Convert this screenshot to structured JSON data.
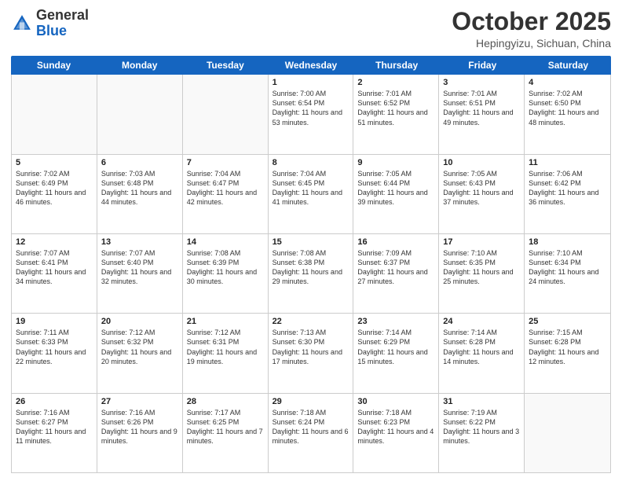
{
  "header": {
    "logo_general": "General",
    "logo_blue": "Blue",
    "month_title": "October 2025",
    "location": "Hepingyizu, Sichuan, China"
  },
  "days_of_week": [
    "Sunday",
    "Monday",
    "Tuesday",
    "Wednesday",
    "Thursday",
    "Friday",
    "Saturday"
  ],
  "weeks": [
    [
      {
        "day": "",
        "sunrise": "",
        "sunset": "",
        "daylight": ""
      },
      {
        "day": "",
        "sunrise": "",
        "sunset": "",
        "daylight": ""
      },
      {
        "day": "",
        "sunrise": "",
        "sunset": "",
        "daylight": ""
      },
      {
        "day": "1",
        "sunrise": "Sunrise: 7:00 AM",
        "sunset": "Sunset: 6:54 PM",
        "daylight": "Daylight: 11 hours and 53 minutes."
      },
      {
        "day": "2",
        "sunrise": "Sunrise: 7:01 AM",
        "sunset": "Sunset: 6:52 PM",
        "daylight": "Daylight: 11 hours and 51 minutes."
      },
      {
        "day": "3",
        "sunrise": "Sunrise: 7:01 AM",
        "sunset": "Sunset: 6:51 PM",
        "daylight": "Daylight: 11 hours and 49 minutes."
      },
      {
        "day": "4",
        "sunrise": "Sunrise: 7:02 AM",
        "sunset": "Sunset: 6:50 PM",
        "daylight": "Daylight: 11 hours and 48 minutes."
      }
    ],
    [
      {
        "day": "5",
        "sunrise": "Sunrise: 7:02 AM",
        "sunset": "Sunset: 6:49 PM",
        "daylight": "Daylight: 11 hours and 46 minutes."
      },
      {
        "day": "6",
        "sunrise": "Sunrise: 7:03 AM",
        "sunset": "Sunset: 6:48 PM",
        "daylight": "Daylight: 11 hours and 44 minutes."
      },
      {
        "day": "7",
        "sunrise": "Sunrise: 7:04 AM",
        "sunset": "Sunset: 6:47 PM",
        "daylight": "Daylight: 11 hours and 42 minutes."
      },
      {
        "day": "8",
        "sunrise": "Sunrise: 7:04 AM",
        "sunset": "Sunset: 6:45 PM",
        "daylight": "Daylight: 11 hours and 41 minutes."
      },
      {
        "day": "9",
        "sunrise": "Sunrise: 7:05 AM",
        "sunset": "Sunset: 6:44 PM",
        "daylight": "Daylight: 11 hours and 39 minutes."
      },
      {
        "day": "10",
        "sunrise": "Sunrise: 7:05 AM",
        "sunset": "Sunset: 6:43 PM",
        "daylight": "Daylight: 11 hours and 37 minutes."
      },
      {
        "day": "11",
        "sunrise": "Sunrise: 7:06 AM",
        "sunset": "Sunset: 6:42 PM",
        "daylight": "Daylight: 11 hours and 36 minutes."
      }
    ],
    [
      {
        "day": "12",
        "sunrise": "Sunrise: 7:07 AM",
        "sunset": "Sunset: 6:41 PM",
        "daylight": "Daylight: 11 hours and 34 minutes."
      },
      {
        "day": "13",
        "sunrise": "Sunrise: 7:07 AM",
        "sunset": "Sunset: 6:40 PM",
        "daylight": "Daylight: 11 hours and 32 minutes."
      },
      {
        "day": "14",
        "sunrise": "Sunrise: 7:08 AM",
        "sunset": "Sunset: 6:39 PM",
        "daylight": "Daylight: 11 hours and 30 minutes."
      },
      {
        "day": "15",
        "sunrise": "Sunrise: 7:08 AM",
        "sunset": "Sunset: 6:38 PM",
        "daylight": "Daylight: 11 hours and 29 minutes."
      },
      {
        "day": "16",
        "sunrise": "Sunrise: 7:09 AM",
        "sunset": "Sunset: 6:37 PM",
        "daylight": "Daylight: 11 hours and 27 minutes."
      },
      {
        "day": "17",
        "sunrise": "Sunrise: 7:10 AM",
        "sunset": "Sunset: 6:35 PM",
        "daylight": "Daylight: 11 hours and 25 minutes."
      },
      {
        "day": "18",
        "sunrise": "Sunrise: 7:10 AM",
        "sunset": "Sunset: 6:34 PM",
        "daylight": "Daylight: 11 hours and 24 minutes."
      }
    ],
    [
      {
        "day": "19",
        "sunrise": "Sunrise: 7:11 AM",
        "sunset": "Sunset: 6:33 PM",
        "daylight": "Daylight: 11 hours and 22 minutes."
      },
      {
        "day": "20",
        "sunrise": "Sunrise: 7:12 AM",
        "sunset": "Sunset: 6:32 PM",
        "daylight": "Daylight: 11 hours and 20 minutes."
      },
      {
        "day": "21",
        "sunrise": "Sunrise: 7:12 AM",
        "sunset": "Sunset: 6:31 PM",
        "daylight": "Daylight: 11 hours and 19 minutes."
      },
      {
        "day": "22",
        "sunrise": "Sunrise: 7:13 AM",
        "sunset": "Sunset: 6:30 PM",
        "daylight": "Daylight: 11 hours and 17 minutes."
      },
      {
        "day": "23",
        "sunrise": "Sunrise: 7:14 AM",
        "sunset": "Sunset: 6:29 PM",
        "daylight": "Daylight: 11 hours and 15 minutes."
      },
      {
        "day": "24",
        "sunrise": "Sunrise: 7:14 AM",
        "sunset": "Sunset: 6:28 PM",
        "daylight": "Daylight: 11 hours and 14 minutes."
      },
      {
        "day": "25",
        "sunrise": "Sunrise: 7:15 AM",
        "sunset": "Sunset: 6:28 PM",
        "daylight": "Daylight: 11 hours and 12 minutes."
      }
    ],
    [
      {
        "day": "26",
        "sunrise": "Sunrise: 7:16 AM",
        "sunset": "Sunset: 6:27 PM",
        "daylight": "Daylight: 11 hours and 11 minutes."
      },
      {
        "day": "27",
        "sunrise": "Sunrise: 7:16 AM",
        "sunset": "Sunset: 6:26 PM",
        "daylight": "Daylight: 11 hours and 9 minutes."
      },
      {
        "day": "28",
        "sunrise": "Sunrise: 7:17 AM",
        "sunset": "Sunset: 6:25 PM",
        "daylight": "Daylight: 11 hours and 7 minutes."
      },
      {
        "day": "29",
        "sunrise": "Sunrise: 7:18 AM",
        "sunset": "Sunset: 6:24 PM",
        "daylight": "Daylight: 11 hours and 6 minutes."
      },
      {
        "day": "30",
        "sunrise": "Sunrise: 7:18 AM",
        "sunset": "Sunset: 6:23 PM",
        "daylight": "Daylight: 11 hours and 4 minutes."
      },
      {
        "day": "31",
        "sunrise": "Sunrise: 7:19 AM",
        "sunset": "Sunset: 6:22 PM",
        "daylight": "Daylight: 11 hours and 3 minutes."
      },
      {
        "day": "",
        "sunrise": "",
        "sunset": "",
        "daylight": ""
      }
    ]
  ]
}
